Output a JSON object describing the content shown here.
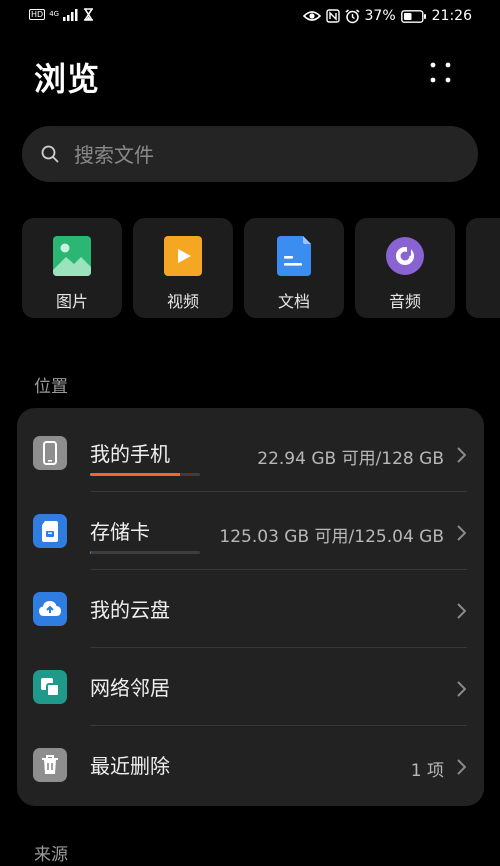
{
  "status_bar": {
    "hd": "HD",
    "network": "4G",
    "battery": "37%",
    "time": "21:26"
  },
  "header": {
    "title": "浏览"
  },
  "search": {
    "placeholder": "搜索文件"
  },
  "categories": [
    {
      "label": "图片",
      "icon": "image-icon",
      "color": "#2bb673"
    },
    {
      "label": "视频",
      "icon": "video-icon",
      "color": "#f5a623"
    },
    {
      "label": "文档",
      "icon": "document-icon",
      "color": "#3b8ef0"
    },
    {
      "label": "音频",
      "icon": "audio-icon",
      "color": "#8a63d2"
    }
  ],
  "locations": {
    "label": "位置",
    "items": [
      {
        "name": "我的手机",
        "value": "22.94 GB 可用/128 GB",
        "icon": "phone-icon",
        "usage_percent": 82,
        "usage_color": "#f06a1f"
      },
      {
        "name": "存储卡",
        "value": "125.03 GB 可用/125.04 GB",
        "icon": "sd-card-icon",
        "usage_percent": 1,
        "usage_color": "#3b8ef0"
      },
      {
        "name": "我的云盘",
        "value": "",
        "icon": "cloud-drive-icon"
      },
      {
        "name": "网络邻居",
        "value": "",
        "icon": "network-neighbor-icon"
      },
      {
        "name": "最近删除",
        "value": "1 项",
        "icon": "trash-icon"
      }
    ]
  },
  "sources": {
    "label": "来源"
  }
}
